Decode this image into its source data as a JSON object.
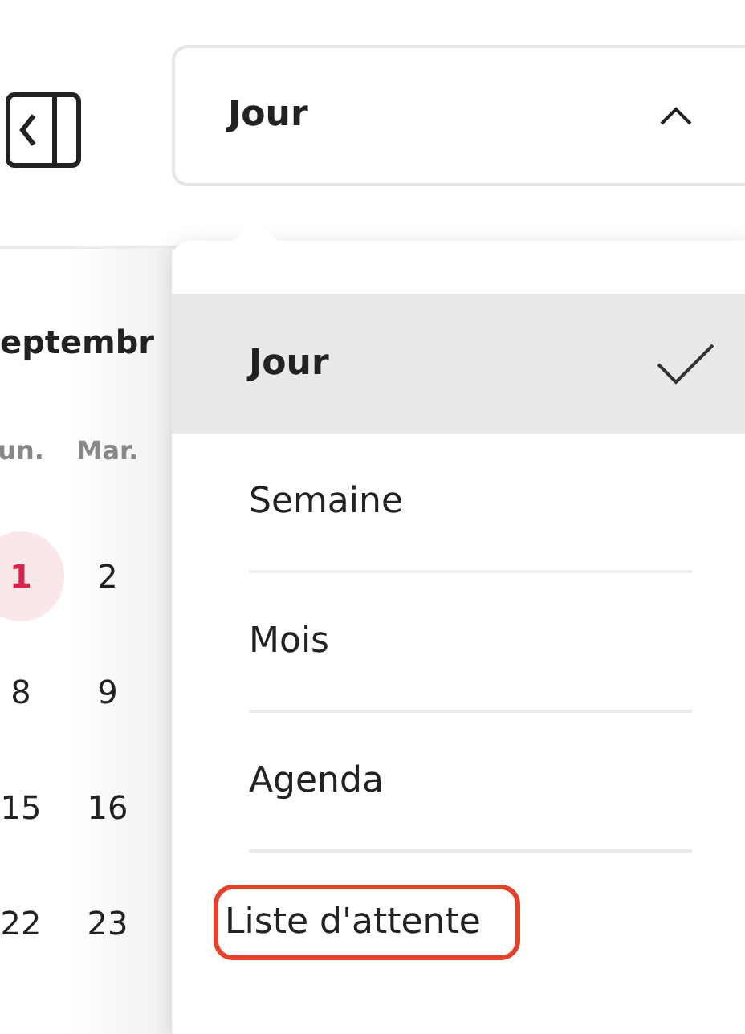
{
  "view_select": {
    "label": "Jour",
    "expanded": true
  },
  "calendar": {
    "month": "eptembr",
    "weekdays": [
      "un.",
      "Mar."
    ],
    "weeks": [
      [
        {
          "day": "1",
          "today": true
        },
        {
          "day": "2",
          "today": false
        }
      ],
      [
        {
          "day": "8",
          "today": false
        },
        {
          "day": "9",
          "today": false
        }
      ],
      [
        {
          "day": "15",
          "today": false
        },
        {
          "day": "16",
          "today": false
        }
      ],
      [
        {
          "day": "22",
          "today": false
        },
        {
          "day": "23",
          "today": false
        }
      ]
    ]
  },
  "menu": [
    {
      "label": "Jour",
      "selected": true,
      "circled": false
    },
    {
      "label": "Semaine",
      "selected": false,
      "circled": false
    },
    {
      "label": "Mois",
      "selected": false,
      "circled": false
    },
    {
      "label": "Agenda",
      "selected": false,
      "circled": false
    },
    {
      "label": "Liste d'attente",
      "selected": false,
      "circled": true
    }
  ]
}
